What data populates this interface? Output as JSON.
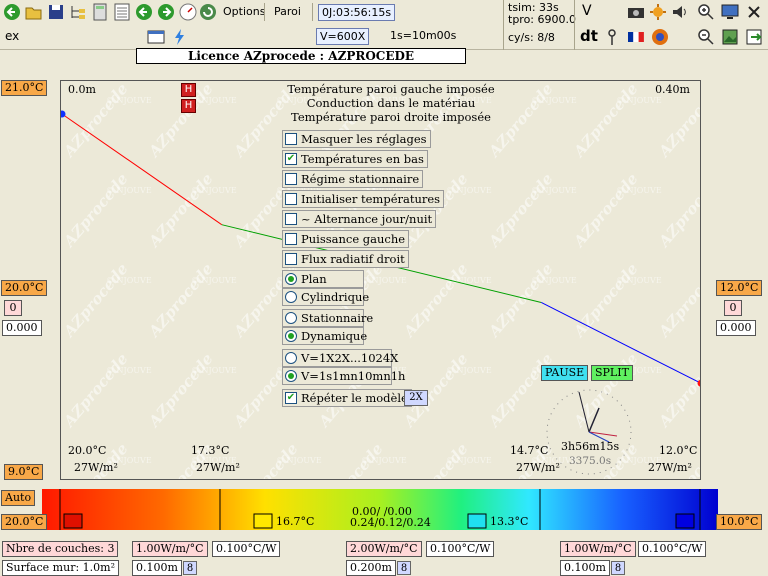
{
  "toolbar": {
    "menu_options": "Options",
    "menu_paroi": "Paroi",
    "clock_display": "0J:03:56:15s",
    "speed_display": "V=600X",
    "scale_display": "1s=10m00s",
    "mode_label": "ex",
    "tsim": "tsim:  33s",
    "tpro": "tpro: 6900.0",
    "cys": "cy/s: 8/8",
    "v_label": "V",
    "dt_label": "dt"
  },
  "licence": "Licence AZprocede : AZPROCEDE",
  "plot": {
    "pos_left": "0.0m",
    "pos_right": "0.40m",
    "title_line1": "Température paroi gauche imposée",
    "title_line2": "Conduction dans le matériau",
    "title_line3": "Température paroi droite imposée",
    "h_marker": "H",
    "temp_axis_top": "21.0°C",
    "temp_axis_mid": "20.0°C",
    "temp_axis_bottom": "9.0°C",
    "left_value_zero": "0",
    "left_value_flux": "0.000",
    "right_temp": "12.0°C",
    "right_value_zero": "0",
    "right_value_flux": "0.000",
    "interfaces": [
      {
        "temp": "20.0°C",
        "flux": "27W/m²"
      },
      {
        "temp": "17.3°C",
        "flux": "27W/m²"
      },
      {
        "temp": "14.7°C",
        "flux": "27W/m²"
      },
      {
        "temp": "12.0°C",
        "flux": "27W/m²"
      }
    ],
    "profile": {
      "x_m": [
        0.0,
        0.1,
        0.3,
        0.4
      ],
      "temp_c": [
        21.0,
        17.3,
        14.7,
        12.0
      ],
      "colors": [
        "#ff0000",
        "#00a000",
        "#0000ff"
      ]
    },
    "options": {
      "masquer": "Masquer les réglages",
      "temp_bas": "Températures en bas",
      "regime": "Régime stationnaire",
      "init": "Initialiser températures",
      "alternance": "~ Alternance jour/nuit",
      "puissance": "Puissance gauche",
      "flux_radiatif": "Flux radiatif droit",
      "plan": "Plan",
      "cylindrique": "Cylindrique",
      "stationnaire": "Stationnaire",
      "dynamique": "Dynamique",
      "v_1x": "V=1X2X...1024X",
      "v_1s": "V=1s1mn10mn1h",
      "repeter": "Répéter le modèle",
      "repeter_value": "2X"
    },
    "pause": "PAUSE",
    "split": "SPLIT",
    "clock_time": "3h56m15s",
    "clock_seconds": "3375.0s",
    "watermark": "AZprocede",
    "watermark2": "© NJOUVE"
  },
  "colorbar": {
    "auto": "Auto",
    "left_temp": "20.0°C",
    "right_temp": "10.0°C",
    "mid_temp1": "16.7°C",
    "mid_temp2": "13.3°C",
    "center_line1": "0.00/ /0.00",
    "center_line2": "0.24/0.12/0.24"
  },
  "bottom": {
    "nb_couches": "Nbre de couches: 3",
    "surface": "Surface mur: 1.0m²",
    "layers": [
      {
        "lambda": "1.00W/m/°C",
        "resist": "0.100°C/W",
        "thick": "0.100m",
        "n": "8"
      },
      {
        "lambda": "2.00W/m/°C",
        "resist": "0.100°C/W",
        "thick": "0.200m",
        "n": "8"
      },
      {
        "lambda": "1.00W/m/°C",
        "resist": "0.100°C/W",
        "thick": "0.100m",
        "n": "8"
      }
    ]
  }
}
